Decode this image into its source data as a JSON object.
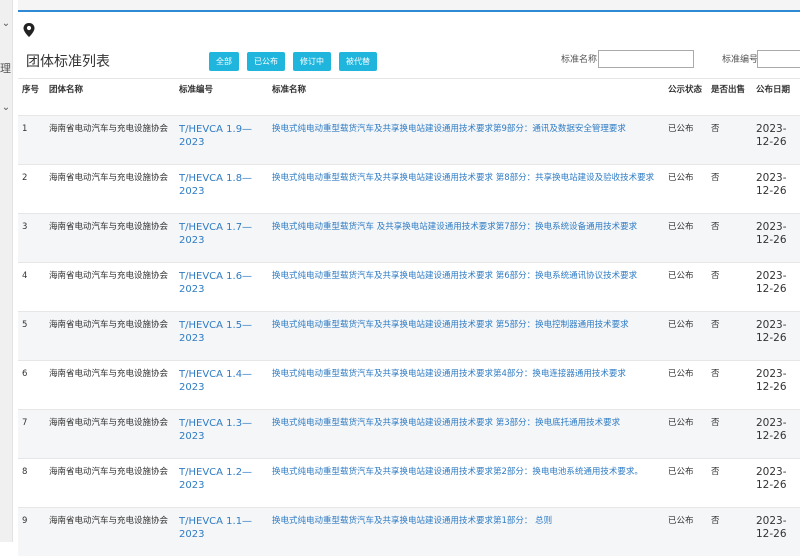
{
  "sidebar": {
    "chevron_top": "⌄",
    "label_fragment": "理",
    "chevron_bottom": "⌄"
  },
  "header": {
    "title": "团体标准列表"
  },
  "filters": [
    {
      "label": "全部"
    },
    {
      "label": "已公布"
    },
    {
      "label": "修订中"
    },
    {
      "label": "被代替"
    }
  ],
  "search": {
    "name_label": "标准名称",
    "code_label": "标准编号"
  },
  "table": {
    "columns": [
      "序号",
      "团体名称",
      "标准编号",
      "标准名称",
      "公示状态",
      "是否出售",
      "公布日期"
    ],
    "rows": [
      {
        "no": "1",
        "org": "海南省电动汽车与充电设施协会",
        "code": "T/HEVCA 1.9—2023",
        "name": "换电式纯电动重型载货汽车及共享换电站建设通用技术要求第9部分：通讯及数据安全管理要求",
        "status": "已公布",
        "sale": "否",
        "date": "2023-12-26"
      },
      {
        "no": "2",
        "org": "海南省电动汽车与充电设施协会",
        "code": "T/HEVCA 1.8—2023",
        "name": "换电式纯电动重型载货汽车及共享换电站建设通用技术要求 第8部分：共享换电站建设及验收技术要求",
        "status": "已公布",
        "sale": "否",
        "date": "2023-12-26"
      },
      {
        "no": "3",
        "org": "海南省电动汽车与充电设施协会",
        "code": "T/HEVCA 1.7—2023",
        "name": "换电式纯电动重型载货汽车 及共享换电站建设通用技术要求第7部分：换电系统设备通用技术要求",
        "status": "已公布",
        "sale": "否",
        "date": "2023-12-26"
      },
      {
        "no": "4",
        "org": "海南省电动汽车与充电设施协会",
        "code": "T/HEVCA 1.6—2023",
        "name": "换电式纯电动重型载货汽车及共享换电站建设通用技术要求 第6部分：换电系统通讯协议技术要求",
        "status": "已公布",
        "sale": "否",
        "date": "2023-12-26"
      },
      {
        "no": "5",
        "org": "海南省电动汽车与充电设施协会",
        "code": "T/HEVCA 1.5—2023",
        "name": "换电式纯电动重型载货汽车及共享换电站建设通用技术要求 第5部分：换电控制器通用技术要求",
        "status": "已公布",
        "sale": "否",
        "date": "2023-12-26"
      },
      {
        "no": "6",
        "org": "海南省电动汽车与充电设施协会",
        "code": "T/HEVCA 1.4—2023",
        "name": "换电式纯电动重型载货汽车及共享换电站建设通用技术要求第4部分：换电连接器通用技术要求",
        "status": "已公布",
        "sale": "否",
        "date": "2023-12-26"
      },
      {
        "no": "7",
        "org": "海南省电动汽车与充电设施协会",
        "code": "T/HEVCA 1.3—2023",
        "name": "换电式纯电动重型载货汽车及共享换电站建设通用技术要求 第3部分：换电底托通用技术要求",
        "status": "已公布",
        "sale": "否",
        "date": "2023-12-26"
      },
      {
        "no": "8",
        "org": "海南省电动汽车与充电设施协会",
        "code": "T/HEVCA 1.2—2023",
        "name": "换电式纯电动重型载货汽车及共享换电站建设通用技术要求第2部分：换电电池系统通用技术要求。",
        "status": "已公布",
        "sale": "否",
        "date": "2023-12-26"
      },
      {
        "no": "9",
        "org": "海南省电动汽车与充电设施协会",
        "code": "T/HEVCA 1.1—2023",
        "name": "换电式纯电动重型载货汽车及共享换电站建设通用技术要求第1部分： 总则",
        "status": "已公布",
        "sale": "否",
        "date": "2023-12-26"
      }
    ]
  }
}
